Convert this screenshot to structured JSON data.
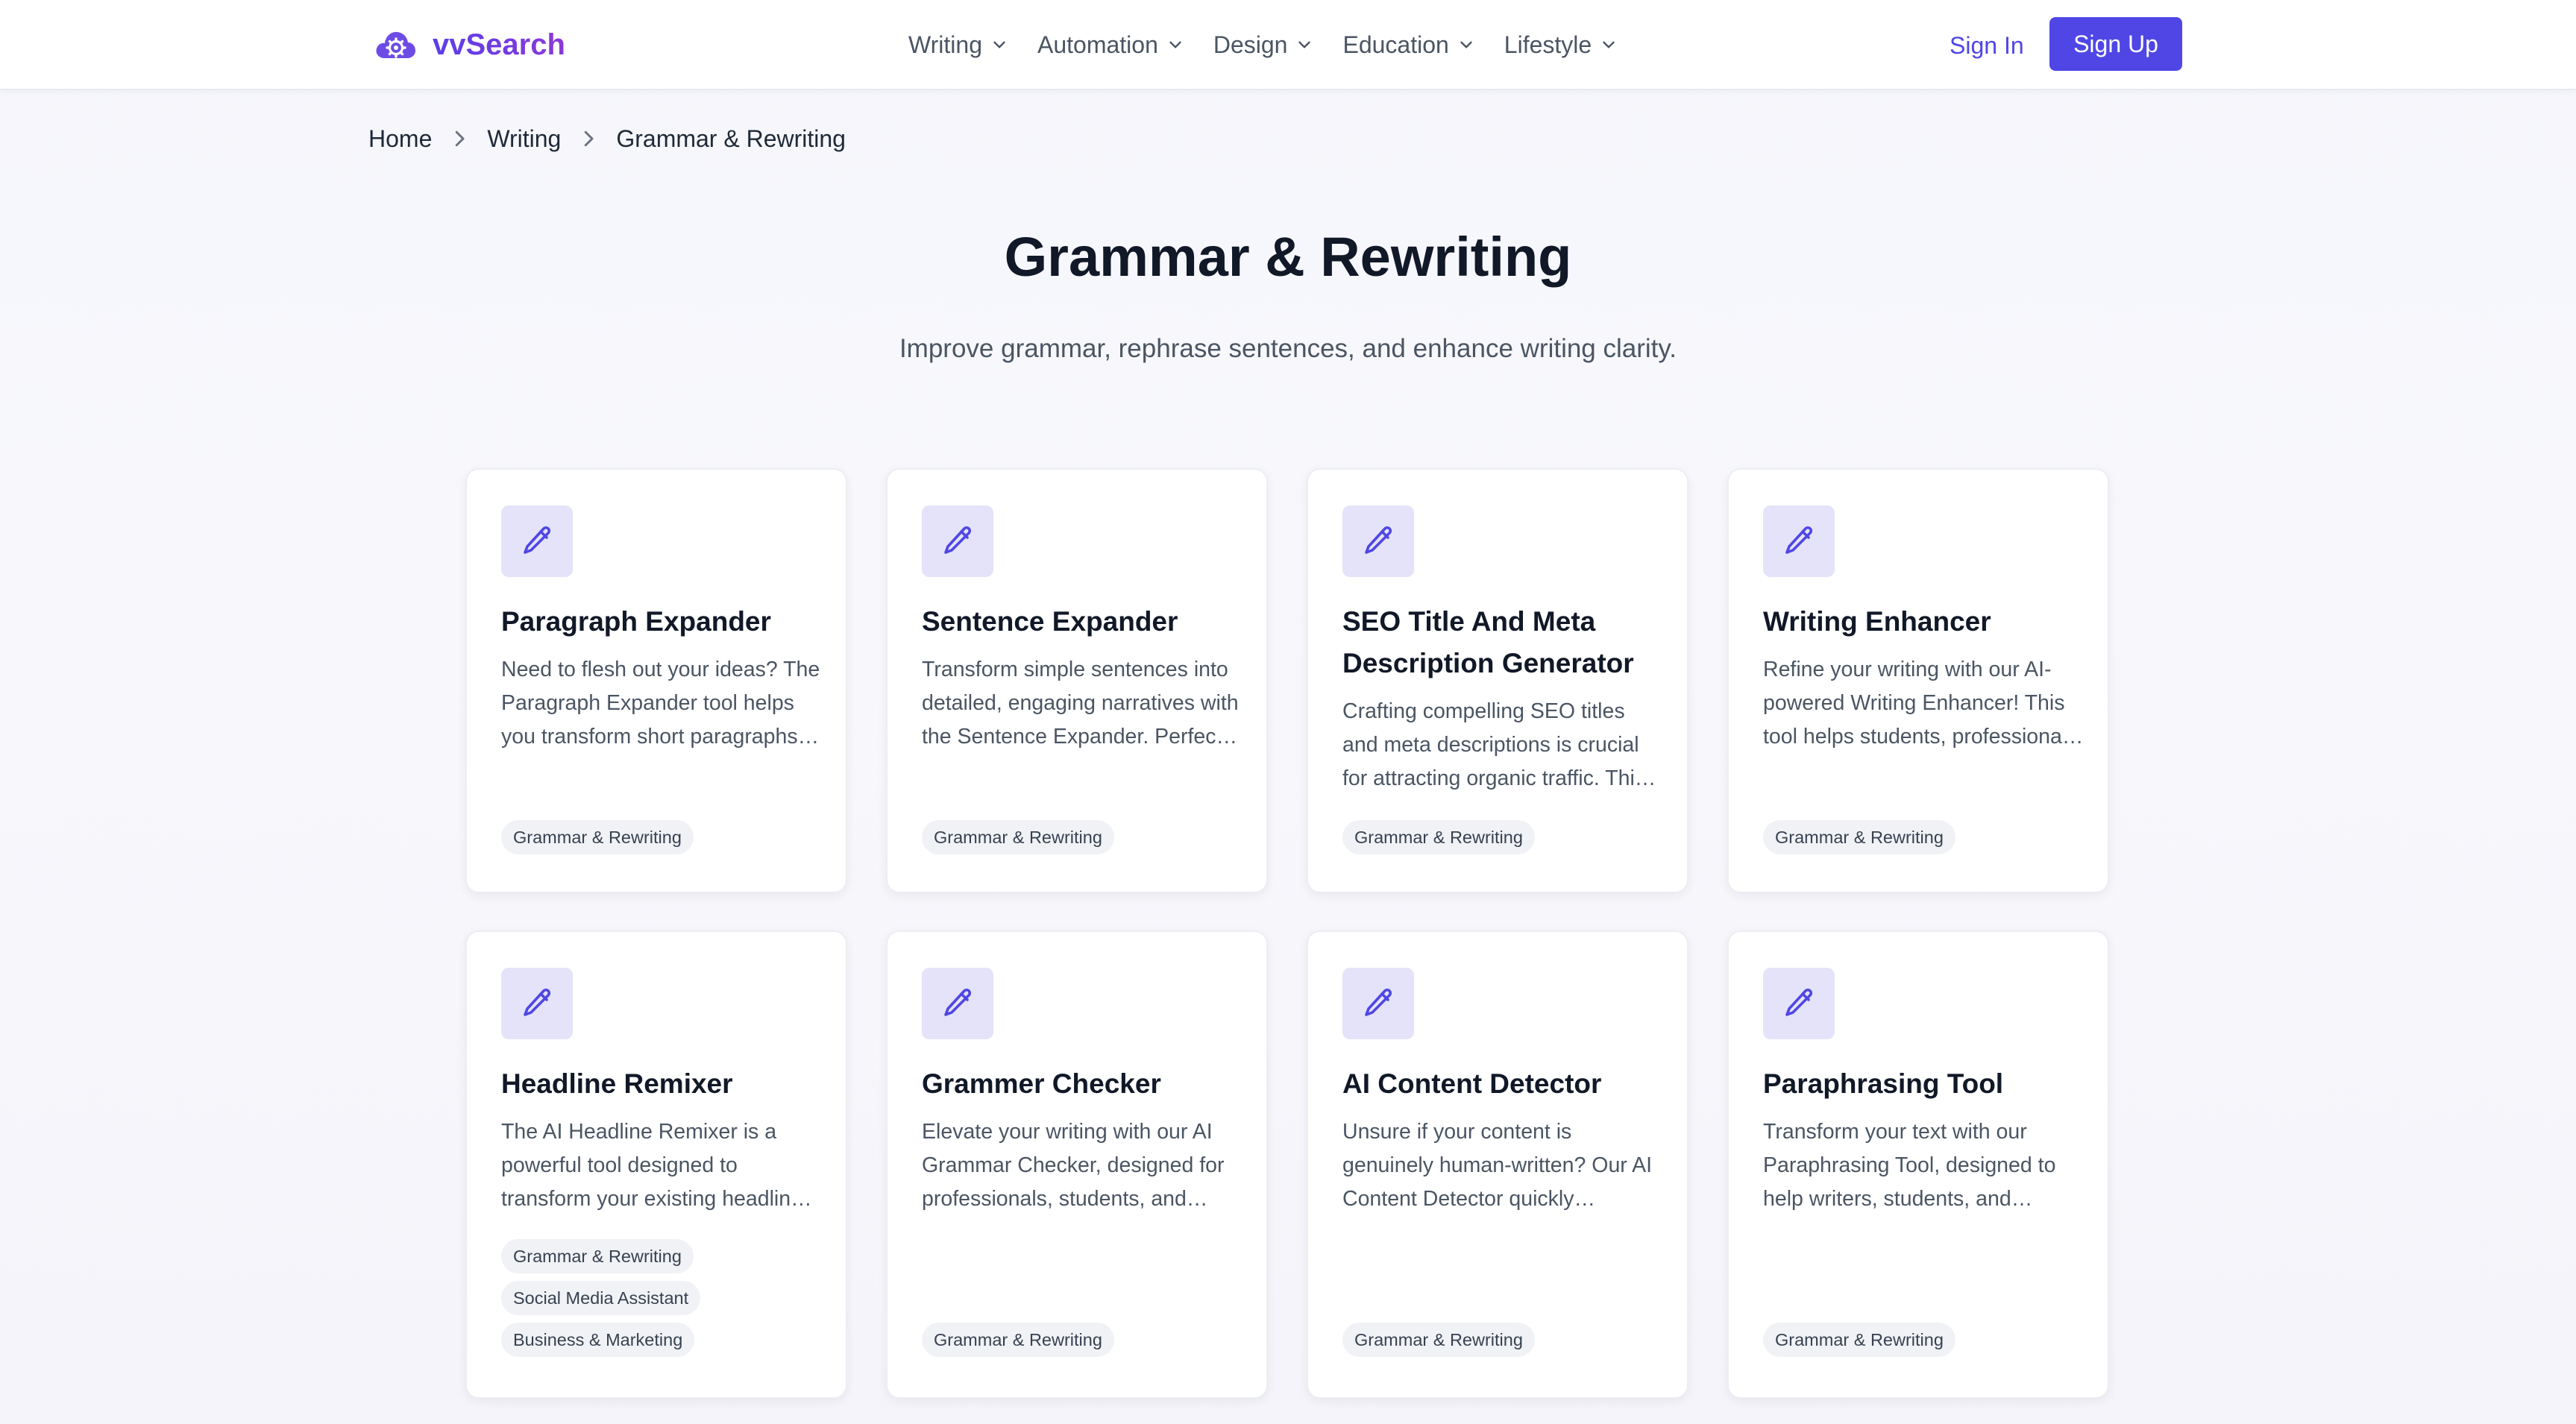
{
  "brand": {
    "name": "vvSearch",
    "accent": "#4f46e5"
  },
  "nav": {
    "items": [
      {
        "label": "Writing"
      },
      {
        "label": "Automation"
      },
      {
        "label": "Design"
      },
      {
        "label": "Education"
      },
      {
        "label": "Lifestyle"
      }
    ],
    "sign_in": "Sign In",
    "sign_up": "Sign Up"
  },
  "breadcrumb": [
    "Home",
    "Writing",
    "Grammar & Rewriting"
  ],
  "page": {
    "title": "Grammar & Rewriting",
    "subtitle": "Improve grammar, rephrase sentences, and enhance writing clarity."
  },
  "cards": [
    {
      "title": "Paragraph Expander",
      "desc": "Need to flesh out your ideas? The Paragraph Expander tool helps you transform short paragraphs into detailed, well-structured content.",
      "tags": [
        "Grammar & Rewriting"
      ]
    },
    {
      "title": "Sentence Expander",
      "desc": "Transform simple sentences into detailed, engaging narratives with the Sentence Expander. Perfect for writers and students.",
      "tags": [
        "Grammar & Rewriting"
      ]
    },
    {
      "title": "SEO Title And Meta Description Generator",
      "desc": "Crafting compelling SEO titles and meta descriptions is crucial for attracting organic traffic. This tool helps you create them fast.",
      "tags": [
        "Grammar & Rewriting"
      ]
    },
    {
      "title": "Writing Enhancer",
      "desc": "Refine your writing with our AI-powered Writing Enhancer! This tool helps students, professionals and writers polish their text.",
      "tags": [
        "Grammar & Rewriting"
      ]
    },
    {
      "title": "Headline Remixer",
      "desc": "The AI Headline Remixer is a powerful tool designed to transform your existing headlines into fresh, engaging variations.",
      "tags": [
        "Grammar & Rewriting",
        "Social Media Assistant",
        "Business & Marketing"
      ]
    },
    {
      "title": "Grammer Checker",
      "desc": "Elevate your writing with our AI Grammar Checker, designed for professionals, students, and writers who want flawless text.",
      "tags": [
        "Grammar & Rewriting"
      ]
    },
    {
      "title": "AI Content Detector",
      "desc": "Unsure if your content is genuinely human-written? Our AI Content Detector quickly analyzes your text for AI patterns.",
      "tags": [
        "Grammar & Rewriting"
      ]
    },
    {
      "title": "Paraphrasing Tool",
      "desc": "Transform your text with our Paraphrasing Tool, designed to help writers, students, and professionals rephrase content.",
      "tags": [
        "Grammar & Rewriting"
      ]
    }
  ],
  "icons": {
    "logo": "cloud-gear-icon",
    "nav_dropdown": "chevron-down-icon",
    "breadcrumb_separator": "chevron-right-icon",
    "card": "pencil-icon"
  }
}
